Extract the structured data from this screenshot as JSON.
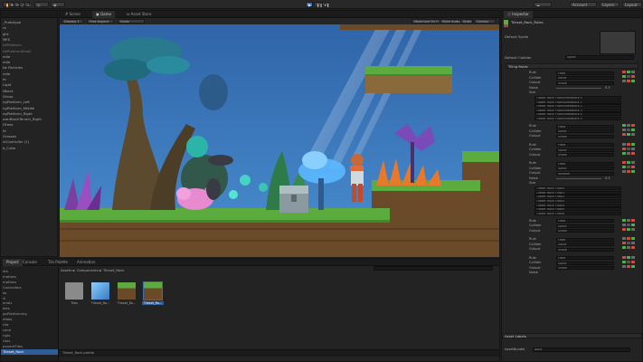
{
  "toolbar": {
    "layers_label": "Layers",
    "layout_label": "Layout",
    "account_label": "Account"
  },
  "scene_tabs": [
    {
      "label": "Scene"
    },
    {
      "label": "Game"
    },
    {
      "label": "Asset Store"
    }
  ],
  "scene_bar": {
    "display": "Display 1",
    "aspect": "Free Aspect",
    "scale": "Scale",
    "options": [
      "Maximize On Play",
      "Mute Audio",
      "Stats",
      "Gizmos"
    ]
  },
  "hierarchy": {
    "items": [
      {
        "label": "_Prototype",
        "style": "normal"
      },
      {
        "label": "ra",
        "style": "normal"
      },
      {
        "label": "ght",
        "style": "normal"
      },
      {
        "label": "MES",
        "style": "normal"
      },
      {
        "label": "tlePlatform",
        "style": "dim"
      },
      {
        "label": "tlePlatformSmall",
        "style": "dim"
      },
      {
        "label": "ndle",
        "style": "normal"
      },
      {
        "label": "ndle",
        "style": "normal"
      },
      {
        "label": "tle Particles",
        "style": "normal"
      },
      {
        "label": "ndle",
        "style": "normal"
      },
      {
        "label": "ht",
        "style": "normal"
      },
      {
        "label": "Light",
        "style": "normal"
      },
      {
        "label": "tBlock",
        "style": "normal"
      },
      {
        "label": "Group",
        "style": "normal"
      },
      {
        "label": "ngPlatform_Left",
        "style": "normal"
      },
      {
        "label": "ngPlatform_Middle",
        "style": "normal"
      },
      {
        "label": "ngPlatform_Right",
        "style": "normal"
      },
      {
        "label": "ownBlockTerrain_Right",
        "style": "normal"
      },
      {
        "label": "tTrees",
        "style": "normal"
      },
      {
        "label": "ht",
        "style": "normal"
      },
      {
        "label": "Grasses",
        "style": "normal"
      },
      {
        "label": "ntController (1)",
        "style": "normal"
      },
      {
        "label": "b_Cube",
        "style": "normal"
      }
    ]
  },
  "project_tabs": [
    {
      "label": "Project"
    },
    {
      "label": "Console"
    },
    {
      "label": "Tile Palette"
    },
    {
      "label": "Animation"
    }
  ],
  "project": {
    "breadcrumb": "Assets ► Components ► Tileset_Rock",
    "tree": [
      {
        "label": "ets",
        "style": "normal"
      },
      {
        "label": "mations",
        "style": "normal"
      },
      {
        "label": "mations",
        "style": "normal"
      },
      {
        "label": "Controllers",
        "style": "normal"
      },
      {
        "label": "ds",
        "style": "normal"
      },
      {
        "label": "rt",
        "style": "normal"
      },
      {
        "label": "erials",
        "style": "normal"
      },
      {
        "label": "eles",
        "style": "normal"
      },
      {
        "label": "ppPlatforming",
        "style": "normal"
      },
      {
        "label": "efabs",
        "style": "normal"
      },
      {
        "label": "rite",
        "style": "normal"
      },
      {
        "label": "cene",
        "style": "normal"
      },
      {
        "label": "ripts",
        "style": "normal"
      },
      {
        "label": "rites",
        "style": "normal"
      },
      {
        "label": "ponentTiles",
        "style": "normal"
      },
      {
        "label": "Tileset_Rock",
        "style": "selected"
      }
    ],
    "assets": [
      {
        "label": "Tiles",
        "kind": "folder"
      },
      {
        "label": "Tileset_Ro...",
        "kind": "cube"
      },
      {
        "label": "Tileset_Ro...",
        "kind": "tile"
      },
      {
        "label": "Tileset_Ro...",
        "kind": "tile-selected"
      }
    ],
    "footer_path": "Tileset_Rock.prefab"
  },
  "inspector": {
    "tab": "Inspector",
    "object_name": "Tileset_Rock_Rules",
    "default_sprite_label": "Default Sprite",
    "default_collider_label": "Default Collider",
    "default_collider_value": "Sprite",
    "section_title": "Tiling Rules",
    "rule_groups": [
      {
        "rule_value": "Fixed",
        "collider_value": "Sprite",
        "output_value": "Single",
        "noise_label": "Noise",
        "noise_value": "0.5",
        "size_label": "Size",
        "sprites": [
          "Tileset_Rock_FloorSingleBlock 0",
          "Tileset_Rock_FloorSingleBlock 1",
          "Tileset_Rock_FloorSingleBlock 2",
          "Tileset_Rock_FloorSingleBlock 3",
          "Tileset_Rock_FloorSingleBlock 4",
          "Tileset_Rock_FloorSingleBlock 5"
        ]
      },
      {
        "rule_value": "Fixed",
        "collider_value": "Sprite",
        "output_value": "Single"
      },
      {
        "rule_value": "Fixed",
        "collider_value": "Sprite",
        "output_value": "Single"
      },
      {
        "rule_value": "Fixed",
        "collider_value": "Sprite",
        "output_value": "Random",
        "noise_label": "Noise",
        "noise_value": "0.5",
        "size_label": "Size",
        "sprites": [
          "Tileset_Rock_Floor0",
          "Tileset_Rock_Floor1",
          "Tileset_Rock_Floor2",
          "Tileset_Rock_Floor3",
          "Tileset_Rock_Floor4",
          "Tileset_Rock_Floor5",
          "Tileset_Rock_Floor6"
        ]
      },
      {
        "rule_value": "Fixed",
        "collider_value": "Sprite",
        "output_value": "Single"
      },
      {
        "rule_value": "Fixed",
        "collider_value": "Sprite",
        "output_value": "Single"
      },
      {
        "rule_value": "Fixed",
        "collider_value": "Sprite",
        "output_value": "Single",
        "noise_label": "Noise"
      }
    ],
    "labels": {
      "rule": "Rule",
      "collider": "Collider",
      "output": "Output"
    },
    "asset_labels_title": "Asset Labels",
    "assetbundle_label": "AssetBundle",
    "assetbundle_value": "None"
  },
  "colors": {
    "accent_blue": "#3d6fb8",
    "selection": "#2f5d99",
    "sky": "#3f7bbf",
    "grass": "#5cab3f",
    "dirt": "#6b4a2a"
  }
}
